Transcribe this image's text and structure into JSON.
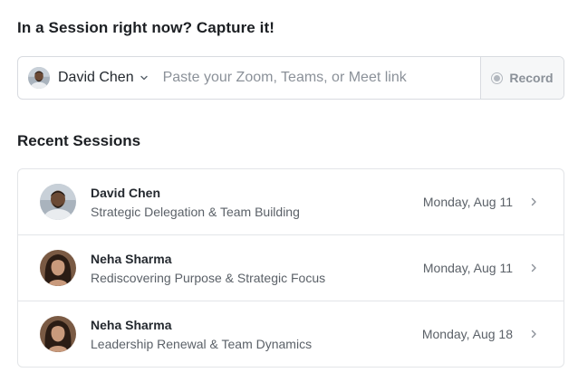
{
  "capture": {
    "title": "In a Session right now? Capture it!",
    "selected_user": "David Chen",
    "link_placeholder": "Paste your Zoom, Teams, or Meet link",
    "record_label": "Record"
  },
  "recent": {
    "title": "Recent Sessions",
    "sessions": [
      {
        "name": "David Chen",
        "topic": "Strategic Delegation & Team Building",
        "date": "Monday, Aug 11",
        "avatar": "male-avatar"
      },
      {
        "name": "Neha Sharma",
        "topic": "Rediscovering Purpose & Strategic Focus",
        "date": "Monday, Aug 11",
        "avatar": "female-avatar"
      },
      {
        "name": "Neha Sharma",
        "topic": "Leadership Renewal & Team Dynamics",
        "date": "Monday, Aug 18",
        "avatar": "female-avatar"
      }
    ]
  },
  "colors": {
    "border": "#d8dbe0",
    "record_bg": "#f6f7f8",
    "muted_text": "#5b6168",
    "placeholder": "#8b9199"
  }
}
